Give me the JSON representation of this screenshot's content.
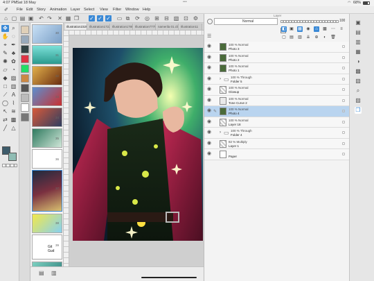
{
  "status": {
    "time": "4:07 PM",
    "date": "Sat 18 May",
    "dots": "•••",
    "battery": "68%"
  },
  "menu": [
    "File",
    "Edit",
    "Story",
    "Animation",
    "Layer",
    "Select",
    "View",
    "Filter",
    "Window",
    "Help"
  ],
  "tabs": [
    "Illustration2329",
    "Illustration1722",
    "Illustration1780",
    "Illustration7775",
    "namerila 01.cli",
    "Illustration11"
  ],
  "strip_numbers": [
    "30",
    "31",
    "32",
    "33",
    "34",
    "35",
    "36",
    "37",
    "38",
    "39",
    "40"
  ],
  "strip_comic_text": "Git\nGud",
  "layer_panel": {
    "title": "Layer",
    "blend_mode": "Normal",
    "opacity": "100",
    "layers": [
      {
        "prop": "100 % Normal",
        "name": "Photo 3",
        "type": "photo"
      },
      {
        "prop": "100 % Normal",
        "name": "Photo 2",
        "type": "photo"
      },
      {
        "prop": "100 % Normal",
        "name": "Photo 1",
        "type": "photo"
      },
      {
        "prop": "100 % Through",
        "name": "Folder 5",
        "type": "folder"
      },
      {
        "prop": "100 % Normal",
        "name": "Glowup",
        "type": "raster"
      },
      {
        "prop": "100 % Normal",
        "name": "Tone Curve 2",
        "type": "correction"
      },
      {
        "prop": "100 % Normal",
        "name": "Photo 4",
        "type": "photo",
        "selected": true
      },
      {
        "prop": "100 % Normal",
        "name": "Layer 18",
        "type": "raster"
      },
      {
        "prop": "100 % Through",
        "name": "Folder 4",
        "type": "folder"
      },
      {
        "prop": "82 % Multiply",
        "name": "Layer 1",
        "type": "raster"
      },
      {
        "prop": "",
        "name": "Paper",
        "type": "paper"
      }
    ]
  },
  "colors": {
    "accent": "#3a89d6",
    "selected_row": "#b9d4ef",
    "main_color": "#3d5c6b",
    "sub_color": "#8fbcb3"
  },
  "icons": {
    "app": "brush-logo-icon",
    "undo": "undo-icon",
    "redo": "redo-icon",
    "eye": "eye-icon",
    "folder": "folder-icon",
    "wifi": "wifi-icon",
    "battery": "battery-icon"
  }
}
